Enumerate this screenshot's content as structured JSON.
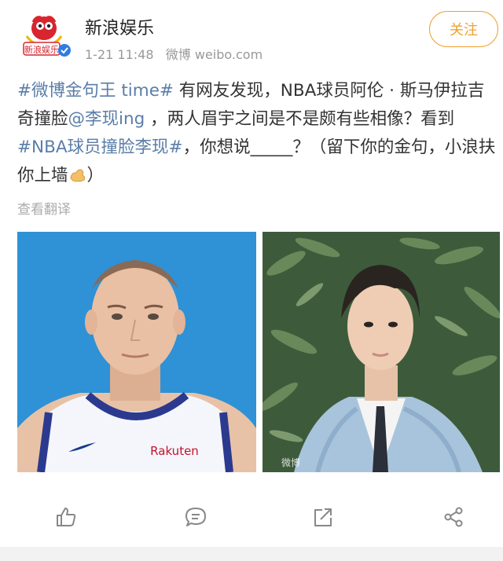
{
  "account": {
    "name": "新浪娱乐",
    "time": "1-21 11:48",
    "source": "微博 weibo.com",
    "avatar_text": "新浪娱乐",
    "follow_label": "关注"
  },
  "post": {
    "hashtag_gold": "#微博金句王 time#",
    "text_1": " 有网友发现，NBA球员阿伦 · 斯马伊拉吉奇撞脸",
    "mention": "@李现ing",
    "text_2": " ，两人眉宇之间是不是颇有些相像？看到",
    "hashtag_topic": "#NBA球员撞脸李现#",
    "text_3": "，你想说_____？（留下你的金句，小浪扶你上墙",
    "text_4": "）",
    "translate_label": "查看翻译"
  },
  "photos": {
    "left_jersey_text": "Rakuten",
    "watermark": "微博"
  },
  "actions": [
    {
      "name": "like",
      "icon": "thumbs-up-icon"
    },
    {
      "name": "comment",
      "icon": "comment-icon"
    },
    {
      "name": "repost",
      "icon": "repost-icon"
    },
    {
      "name": "share",
      "icon": "share-icon"
    }
  ],
  "colors": {
    "link": "#5b7ea8",
    "follow": "#f0a030",
    "meta": "#999999",
    "background": "#f2f2f2"
  }
}
